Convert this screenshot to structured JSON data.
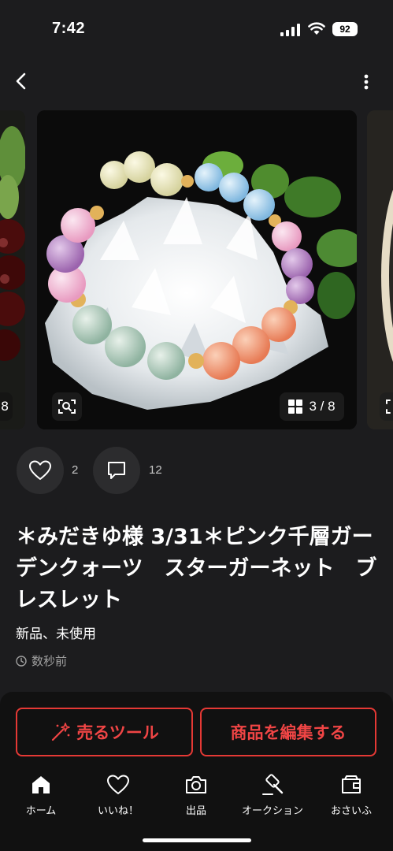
{
  "status_bar": {
    "time": "7:42",
    "battery": "92"
  },
  "gallery": {
    "left_peek_counter": "8",
    "counter": "3 / 8"
  },
  "actions": {
    "like_count": "2",
    "comment_count": "12"
  },
  "item": {
    "title": "＊みだきゆ様 3/31＊ピンク千層ガーデンクォーツ　スターガーネット　ブレスレット",
    "condition": "新品、未使用",
    "posted": "数秒前"
  },
  "bottom_actions": {
    "sell_tool": "売るツール",
    "edit_item": "商品を編集する"
  },
  "tabs": [
    {
      "label": "ホーム",
      "icon": "home-icon"
    },
    {
      "label": "いいね！",
      "icon": "heart-icon"
    },
    {
      "label": "出品",
      "icon": "camera-icon"
    },
    {
      "label": "オークション",
      "icon": "auction-hammer-icon"
    },
    {
      "label": "おさいふ",
      "icon": "wallet-icon"
    }
  ],
  "colors": {
    "background": "#1c1c1e",
    "accent": "#e53935"
  }
}
